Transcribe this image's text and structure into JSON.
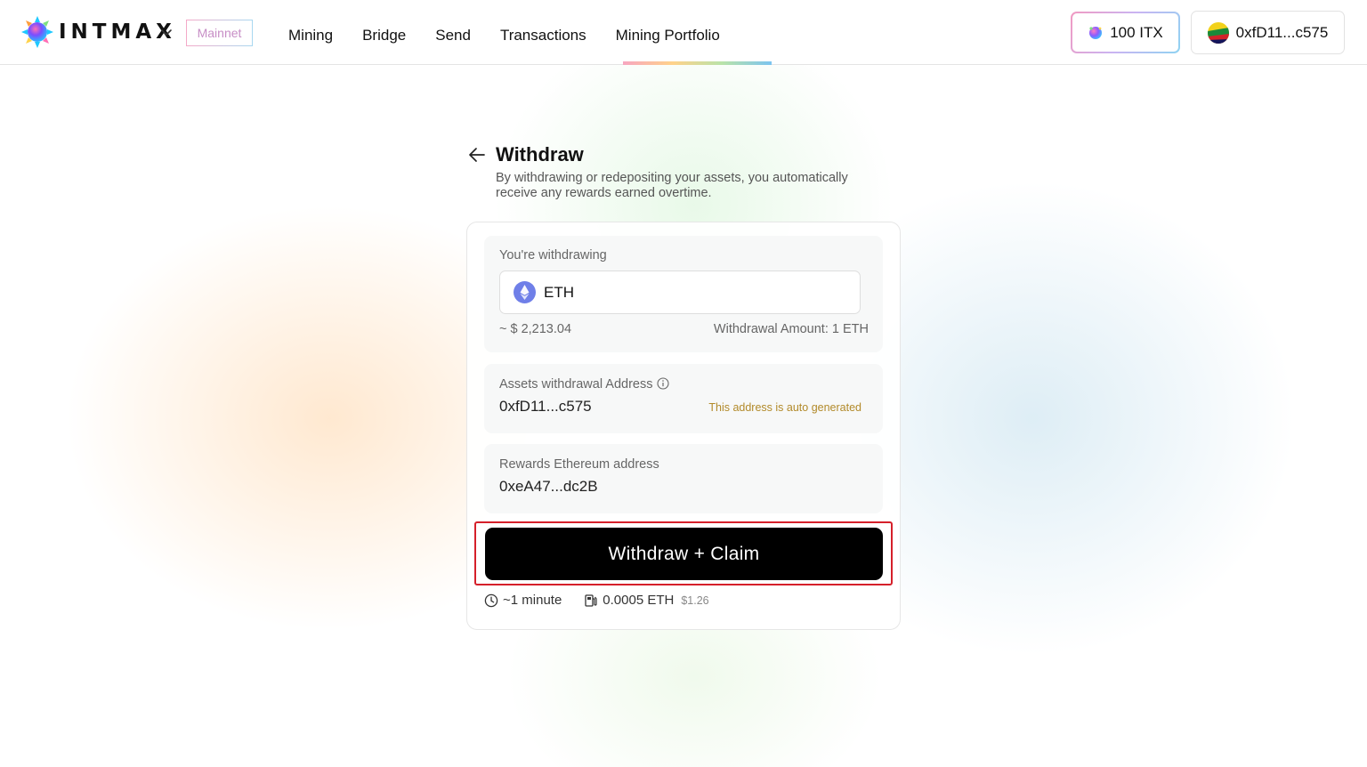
{
  "header": {
    "brand": "INTMAX",
    "network_badge": "Mainnet",
    "nav": [
      "Mining",
      "Bridge",
      "Send",
      "Transactions",
      "Mining Portfolio"
    ],
    "active_nav": "Mining Portfolio",
    "balance_label": "100 ITX",
    "wallet_address": "0xfD11...c575"
  },
  "page": {
    "title": "Withdraw",
    "subtitle": "By withdrawing or redepositing your assets, you automatically receive any rewards earned overtime."
  },
  "withdraw": {
    "label": "You're withdrawing",
    "token": "ETH",
    "usd_value": "~ $ 2,213.04",
    "amount_text": "Withdrawal Amount: 1 ETH"
  },
  "assets_address": {
    "label": "Assets withdrawal Address",
    "value": "0xfD11...c575",
    "note": "This address is auto generated"
  },
  "rewards_address": {
    "label": "Rewards Ethereum address",
    "value": "0xeA47...dc2B"
  },
  "action": {
    "button_label": "Withdraw + Claim"
  },
  "meta": {
    "time": "~1 minute",
    "fee": "0.0005 ETH",
    "fee_usd": "$1.26"
  },
  "colors": {
    "primary_button": "#000000",
    "highlight": "#d5202a",
    "note_text": "#b28a2a"
  }
}
